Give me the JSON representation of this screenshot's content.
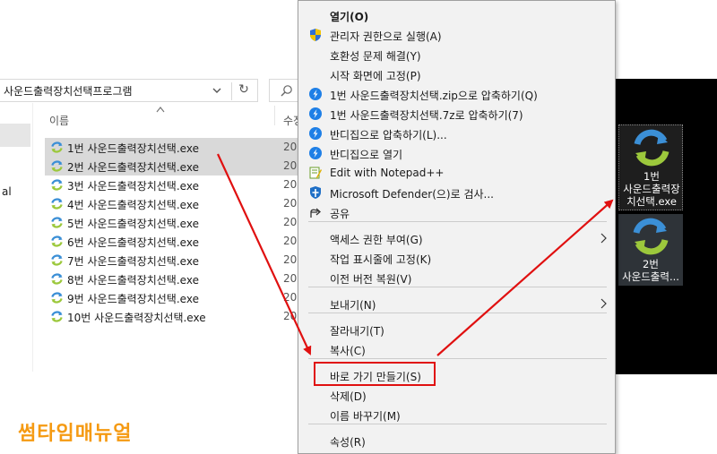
{
  "explorer": {
    "address": "사운드출력장치선택프로그램",
    "column_name": "이름",
    "column_date": "수정",
    "nav_partial": "al",
    "files": [
      {
        "name": "1번 사운드출력장치선택.exe",
        "date": "20",
        "selected": true
      },
      {
        "name": "2번 사운드출력장치선택.exe",
        "date": "20",
        "selected": true
      },
      {
        "name": "3번 사운드출력장치선택.exe",
        "date": "20",
        "selected": false
      },
      {
        "name": "4번 사운드출력장치선택.exe",
        "date": "20",
        "selected": false
      },
      {
        "name": "5번 사운드출력장치선택.exe",
        "date": "20",
        "selected": false
      },
      {
        "name": "6번 사운드출력장치선택.exe",
        "date": "20",
        "selected": false
      },
      {
        "name": "7번 사운드출력장치선택.exe",
        "date": "20",
        "selected": false
      },
      {
        "name": "8번 사운드출력장치선택.exe",
        "date": "20",
        "selected": false
      },
      {
        "name": "9번 사운드출력장치선택.exe",
        "date": "20",
        "selected": false
      },
      {
        "name": "10번 사운드출력장치선택.exe",
        "date": "20",
        "selected": false
      }
    ]
  },
  "context_menu": {
    "items": [
      {
        "label": "열기(O)",
        "icon": "none",
        "bold": true
      },
      {
        "label": "관리자 권한으로 실행(A)",
        "icon": "uac-shield-icon"
      },
      {
        "label": "호환성 문제 해결(Y)",
        "icon": "none"
      },
      {
        "label": "시작 화면에 고정(P)",
        "icon": "none"
      },
      {
        "label": "1번 사운드출력장치선택.zip으로 압축하기(Q)",
        "icon": "bandizip-icon"
      },
      {
        "label": "1번 사운드출력장치선택.7z로 압축하기(7)",
        "icon": "bandizip-icon"
      },
      {
        "label": "반디집으로 압축하기(L)...",
        "icon": "bandizip-icon"
      },
      {
        "label": "반디집으로 열기",
        "icon": "bandizip-icon"
      },
      {
        "label": "Edit with Notepad++",
        "icon": "notepad-plus-icon"
      },
      {
        "label": "Microsoft Defender(으)로 검사...",
        "icon": "defender-icon"
      },
      {
        "label": "공유",
        "icon": "share-icon"
      },
      {
        "label": "액세스 권한 부여(G)",
        "icon": "none",
        "submenu": true
      },
      {
        "label": "작업 표시줄에 고정(K)",
        "icon": "none"
      },
      {
        "label": "이전 버전 복원(V)",
        "icon": "none"
      },
      {
        "label": "보내기(N)",
        "icon": "none",
        "submenu": true
      },
      {
        "label": "잘라내기(T)",
        "icon": "none"
      },
      {
        "label": "복사(C)",
        "icon": "none"
      },
      {
        "label": "바로 가기 만들기(S)",
        "icon": "none",
        "highlighted": true
      },
      {
        "label": "삭제(D)",
        "icon": "none"
      },
      {
        "label": "이름 바꾸기(M)",
        "icon": "none"
      },
      {
        "label": "속성(R)",
        "icon": "none"
      }
    ]
  },
  "desktop": {
    "icon1_line1": "1번",
    "icon1_line2": "사운드출력장",
    "icon1_line3": "치선택.exe",
    "icon2_line1": "2번",
    "icon2_line2": "사운드출력..."
  },
  "brand": "썸타임매뉴얼",
  "colors": {
    "accent_red": "#e01010",
    "brand_orange": "#f59a12",
    "selection_gray": "#d9d9d9",
    "menu_bg": "#f2f2f2"
  }
}
